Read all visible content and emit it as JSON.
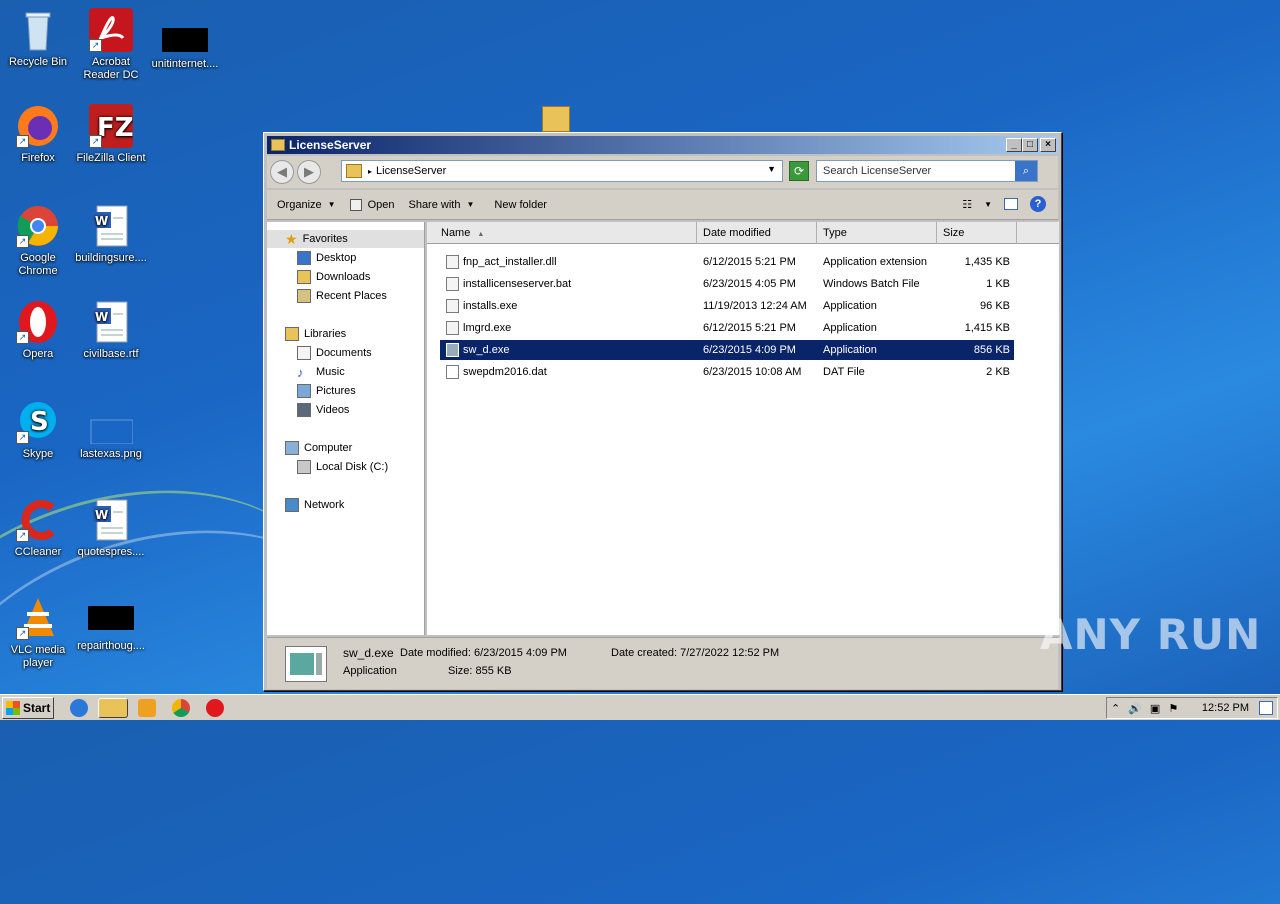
{
  "desktop": {
    "icons": [
      {
        "label": "Recycle Bin",
        "icon": "recycle-bin-icon"
      },
      {
        "label": "Acrobat Reader DC",
        "icon": "acrobat-icon"
      },
      {
        "label": "unitinternet....",
        "icon": "black-thumbnail-icon"
      },
      {
        "label": "Firefox",
        "icon": "firefox-icon"
      },
      {
        "label": "FileZilla Client",
        "icon": "filezilla-icon"
      },
      {
        "label": "Google Chrome",
        "icon": "chrome-icon"
      },
      {
        "label": "buildingsure....",
        "icon": "word-doc-icon"
      },
      {
        "label": "Opera",
        "icon": "opera-icon"
      },
      {
        "label": "civilbase.rtf",
        "icon": "word-doc-icon"
      },
      {
        "label": "Skype",
        "icon": "skype-icon"
      },
      {
        "label": "lastexas.png",
        "icon": "image-icon"
      },
      {
        "label": "CCleaner",
        "icon": "ccleaner-icon"
      },
      {
        "label": "quotespres....",
        "icon": "word-doc-icon"
      },
      {
        "label": "VLC media player",
        "icon": "vlc-icon"
      },
      {
        "label": "repairthoug....",
        "icon": "black-thumbnail-icon"
      }
    ]
  },
  "window": {
    "title": "LicenseServer",
    "address": "LicenseServer",
    "search_placeholder": "Search LicenseServer",
    "toolbar": {
      "organize": "Organize",
      "open": "Open",
      "share_with": "Share with",
      "new_folder": "New folder"
    },
    "nav": {
      "favorites": "Favorites",
      "desktop": "Desktop",
      "downloads": "Downloads",
      "recent_places": "Recent Places",
      "libraries": "Libraries",
      "documents": "Documents",
      "music": "Music",
      "pictures": "Pictures",
      "videos": "Videos",
      "computer": "Computer",
      "local_disk": "Local Disk (C:)",
      "network": "Network"
    },
    "columns": {
      "name": "Name",
      "date_modified": "Date modified",
      "type": "Type",
      "size": "Size"
    },
    "files": [
      {
        "name": "fnp_act_installer.dll",
        "date": "6/12/2015 5:21 PM",
        "type": "Application extension",
        "size": "1,435 KB"
      },
      {
        "name": "installicenseserver.bat",
        "date": "6/23/2015 4:05 PM",
        "type": "Windows Batch File",
        "size": "1 KB"
      },
      {
        "name": "installs.exe",
        "date": "11/19/2013 12:24 AM",
        "type": "Application",
        "size": "96 KB"
      },
      {
        "name": "lmgrd.exe",
        "date": "6/12/2015 5:21 PM",
        "type": "Application",
        "size": "1,415 KB"
      },
      {
        "name": "sw_d.exe",
        "date": "6/23/2015 4:09 PM",
        "type": "Application",
        "size": "856 KB"
      },
      {
        "name": "swepdm2016.dat",
        "date": "6/23/2015 10:08 AM",
        "type": "DAT File",
        "size": "2 KB"
      }
    ],
    "selected_index": 4,
    "details": {
      "name": "sw_d.exe",
      "modified": "Date modified: 6/23/2015 4:09 PM",
      "created": "Date created: 7/27/2022 12:52 PM",
      "type": "Application",
      "size": "Size: 855 KB"
    }
  },
  "taskbar": {
    "start": "Start",
    "clock": "12:52 PM"
  },
  "watermark": "ANY RUN"
}
